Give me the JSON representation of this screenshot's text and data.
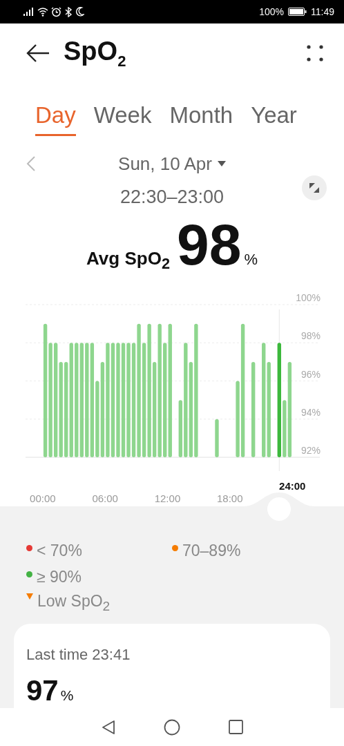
{
  "status_bar": {
    "battery_text": "100%",
    "time": "11:49"
  },
  "header": {
    "title": "SpO$_{2}$"
  },
  "tabs": [
    {
      "label": "Day",
      "selected": true
    },
    {
      "label": "Week",
      "selected": false
    },
    {
      "label": "Month",
      "selected": false
    },
    {
      "label": "Year",
      "selected": false
    }
  ],
  "date": {
    "label": "Sun, 10 Apr",
    "range": "22:30–23:00"
  },
  "average": {
    "label": "Avg SpO$_{2}$",
    "value": "98",
    "unit": "%"
  },
  "chart_data": {
    "type": "bar",
    "x": [
      0.25,
      0.75,
      1.25,
      1.75,
      2.25,
      2.75,
      3.25,
      3.75,
      4.25,
      4.75,
      5.25,
      5.75,
      6.25,
      6.75,
      7.25,
      7.75,
      8.25,
      8.75,
      9.25,
      9.75,
      10.25,
      10.75,
      11.25,
      11.75,
      12.25,
      12.75,
      13.25,
      13.75,
      14.25,
      14.75,
      15.25,
      15.75,
      16.25,
      16.75,
      17.25,
      17.75,
      18.25,
      18.75,
      19.25,
      19.75,
      20.25,
      20.75,
      21.25,
      21.75,
      22.25,
      22.75,
      23.25,
      23.75
    ],
    "series": [
      {
        "color": "#8ed68e",
        "values": [
          99,
          98,
          98,
          97,
          97,
          98,
          98,
          98,
          98,
          98,
          96,
          97,
          98,
          98,
          98,
          98,
          98,
          98,
          99,
          98,
          99,
          97,
          99,
          98,
          99,
          null,
          95,
          98,
          97,
          99,
          null,
          null,
          null,
          94,
          null,
          null,
          null,
          96,
          99,
          null,
          97,
          null,
          98,
          97,
          null,
          null,
          95,
          97
        ]
      },
      {
        "color": "#3cb83c",
        "values": [
          null,
          null,
          null,
          null,
          null,
          null,
          null,
          null,
          null,
          null,
          null,
          null,
          null,
          null,
          null,
          null,
          null,
          null,
          null,
          null,
          null,
          null,
          null,
          null,
          null,
          null,
          null,
          null,
          null,
          null,
          null,
          null,
          null,
          null,
          null,
          null,
          null,
          null,
          null,
          null,
          null,
          null,
          null,
          null,
          null,
          98,
          null,
          null
        ]
      }
    ],
    "xlim": [
      -1.65,
      26.65
    ],
    "ylim": [
      92,
      100
    ],
    "grid": true,
    "xticks": [
      {
        "value": 0,
        "label": "00:00"
      },
      {
        "value": 6,
        "label": "06:00"
      },
      {
        "value": 12,
        "label": "12:00"
      },
      {
        "value": 18,
        "label": "18:00"
      }
    ],
    "yticks": [
      {
        "value": 92,
        "label": "92%"
      },
      {
        "value": 94,
        "label": "94%"
      },
      {
        "value": 96,
        "label": "96%"
      },
      {
        "value": 98,
        "label": "98%"
      },
      {
        "value": 100,
        "label": "100%"
      }
    ]
  },
  "handle_label": "24:00",
  "legend": [
    {
      "label": "< 70%",
      "color": "#e53935",
      "kind": "dot"
    },
    {
      "label": "70–89%",
      "color": "#f57c00",
      "kind": "dot"
    },
    {
      "label": "≥ 90%",
      "color": "#43b244",
      "kind": "dot"
    },
    {
      "label": "Low SpO$_{2}$",
      "color": "#f57c00",
      "kind": "marker"
    }
  ],
  "last_reading": {
    "label": "Last time 23:41",
    "value": "97",
    "unit": "%"
  }
}
